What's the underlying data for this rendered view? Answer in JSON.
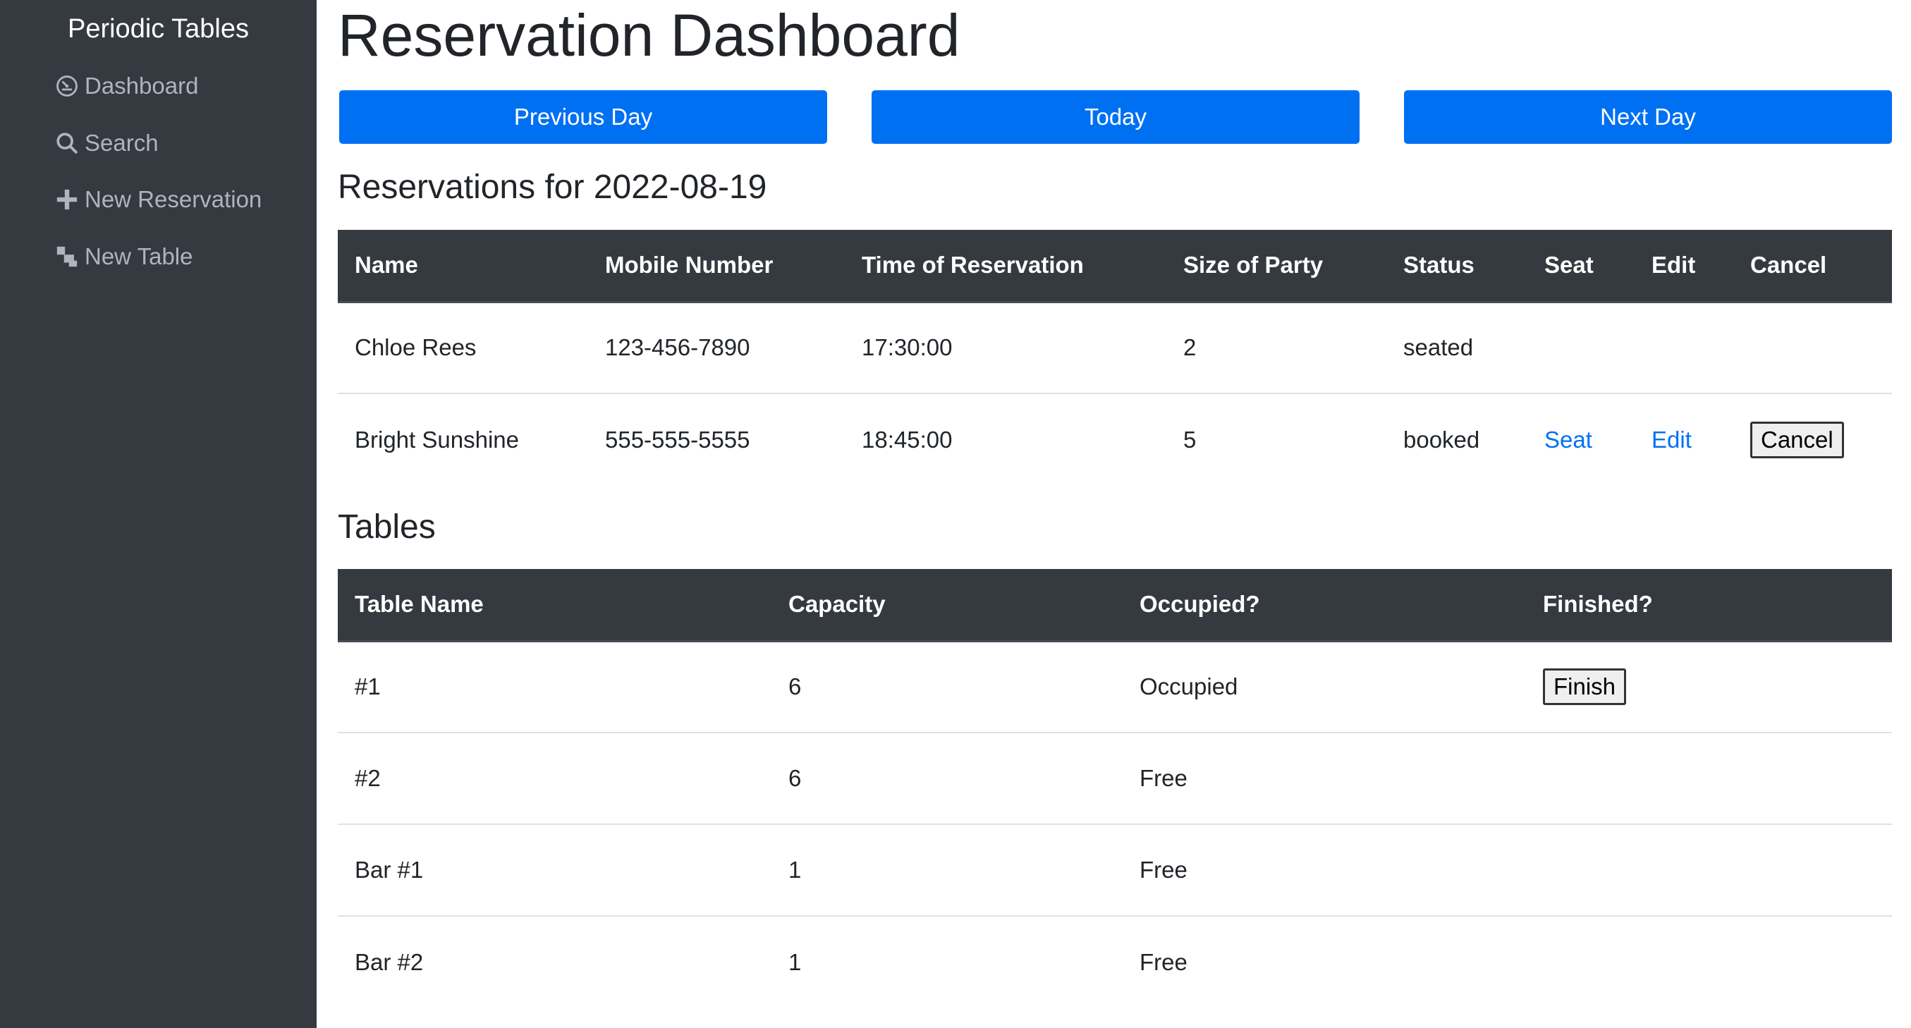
{
  "sidebar": {
    "brand": "Periodic Tables",
    "items": [
      {
        "label": "Dashboard",
        "icon": "dashboard-icon"
      },
      {
        "label": "Search",
        "icon": "search-icon"
      },
      {
        "label": "New Reservation",
        "icon": "plus-icon"
      },
      {
        "label": "New Table",
        "icon": "table-icon"
      }
    ]
  },
  "header": {
    "title": "Reservation Dashboard",
    "prev_label": "Previous Day",
    "today_label": "Today",
    "next_label": "Next Day"
  },
  "reservations": {
    "title": "Reservations for 2022-08-19",
    "columns": [
      "Name",
      "Mobile Number",
      "Time of Reservation",
      "Size of Party",
      "Status",
      "Seat",
      "Edit",
      "Cancel"
    ],
    "rows": [
      {
        "name": "Chloe Rees",
        "mobile": "123-456-7890",
        "time": "17:30:00",
        "size": "2",
        "status": "seated",
        "seat": "",
        "edit": "",
        "cancel": ""
      },
      {
        "name": "Bright Sunshine",
        "mobile": "555-555-5555",
        "time": "18:45:00",
        "size": "5",
        "status": "booked",
        "seat": "Seat",
        "edit": "Edit",
        "cancel": "Cancel"
      }
    ]
  },
  "tables": {
    "title": "Tables",
    "columns": [
      "Table Name",
      "Capacity",
      "Occupied?",
      "Finished?"
    ],
    "rows": [
      {
        "name": "#1",
        "capacity": "6",
        "occupied": "Occupied",
        "finish": "Finish"
      },
      {
        "name": "#2",
        "capacity": "6",
        "occupied": "Free",
        "finish": ""
      },
      {
        "name": "Bar #1",
        "capacity": "1",
        "occupied": "Free",
        "finish": ""
      },
      {
        "name": "Bar #2",
        "capacity": "1",
        "occupied": "Free",
        "finish": ""
      }
    ]
  },
  "colors": {
    "sidebar_bg": "#343a40",
    "primary": "#0070f3",
    "table_header_bg": "#343a40"
  }
}
